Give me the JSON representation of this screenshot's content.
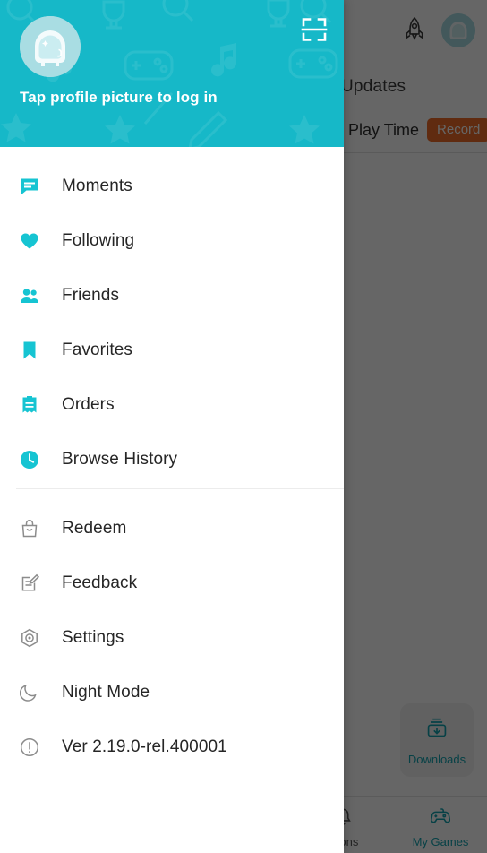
{
  "theme": {
    "accent": "#16b8c8",
    "accent_dark": "#13a3b0",
    "avatar_bg": "#a9dde3",
    "text_primary": "#262626",
    "record_badge": "#ef6c2a",
    "scrim": "rgba(0,0,0,0.60)",
    "divider": "#ececec"
  },
  "drawer": {
    "header": {
      "login_prompt": "Tap profile picture to log in",
      "avatar_icon": "astronaut-helmet-avatar",
      "scan_icon": "scan-qr-icon",
      "pattern_icons": [
        "magnifier-icon",
        "trophy-icon",
        "music-note-icon",
        "gamepad-icon",
        "sword-icon",
        "star-icon"
      ]
    },
    "menu_primary": [
      {
        "label": "Moments",
        "icon": "chat-bubble-icon"
      },
      {
        "label": "Following",
        "icon": "heart-icon"
      },
      {
        "label": "Friends",
        "icon": "friends-icon"
      },
      {
        "label": "Favorites",
        "icon": "bookmark-icon"
      },
      {
        "label": "Orders",
        "icon": "receipt-icon"
      },
      {
        "label": "Browse History",
        "icon": "clock-icon"
      }
    ],
    "menu_secondary": [
      {
        "label": "Redeem",
        "icon": "shopping-bag-icon"
      },
      {
        "label": "Feedback",
        "icon": "edit-note-icon"
      },
      {
        "label": "Settings",
        "icon": "settings-hexagon-icon"
      },
      {
        "label": "Night Mode",
        "icon": "moon-icon"
      },
      {
        "label": "Ver  2.19.0-rel.400001",
        "icon": "info-circle-icon"
      }
    ]
  },
  "background_app": {
    "topbar": {
      "rocket_icon": "rocket-icon",
      "avatar_icon": "astronaut-helmet-avatar"
    },
    "tab_label": "Updates",
    "play_time": {
      "clock_icon": "clock-outline-icon",
      "label": "Play Time",
      "record_button": "Record"
    },
    "downloads_card": {
      "label": "Downloads",
      "icon": "download-box-icon"
    },
    "bottom_tabs": [
      {
        "label": "ations",
        "icon": "bell-icon",
        "active": false
      },
      {
        "label": "My Games",
        "icon": "gamepad-icon",
        "active": true
      }
    ]
  }
}
